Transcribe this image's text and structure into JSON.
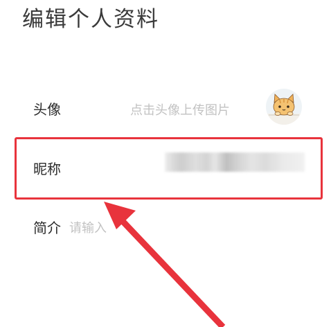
{
  "header": {
    "title": "编辑个人资料"
  },
  "rows": {
    "avatar": {
      "label": "头像",
      "hint": "点击头像上传图片",
      "icon": "cat-avatar-icon"
    },
    "nickname": {
      "label": "昵称",
      "value_state": "blurred"
    },
    "bio": {
      "label": "简介",
      "placeholder": "请输入"
    }
  },
  "annotation": {
    "box_color": "#e8333c",
    "arrow_color": "#e8333c"
  }
}
